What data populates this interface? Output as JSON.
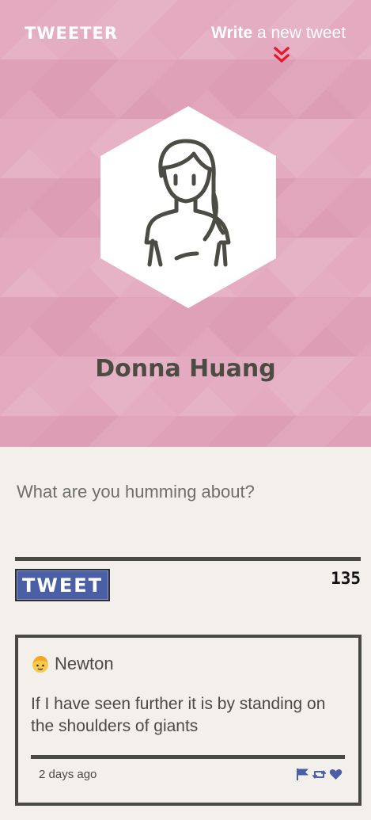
{
  "header": {
    "brand": "TWEETER",
    "write_bold": "Write",
    "write_rest": " a new tweet",
    "profile_name": "Donna Huang",
    "background_color": "#e3a6bc",
    "accent_color": "#e3182d"
  },
  "compose": {
    "placeholder": "What are you humming about?",
    "button_label": "TWEET",
    "char_count": "135",
    "button_color": "#4b5fa6"
  },
  "tweets": [
    {
      "author": "Newton",
      "avatar_icon": "person-emoji-icon",
      "text": "If I have seen further it is by standing on the shoulders of giants",
      "time": "2 days ago",
      "actions": [
        "flag-icon",
        "retweet-icon",
        "heart-icon"
      ]
    }
  ]
}
